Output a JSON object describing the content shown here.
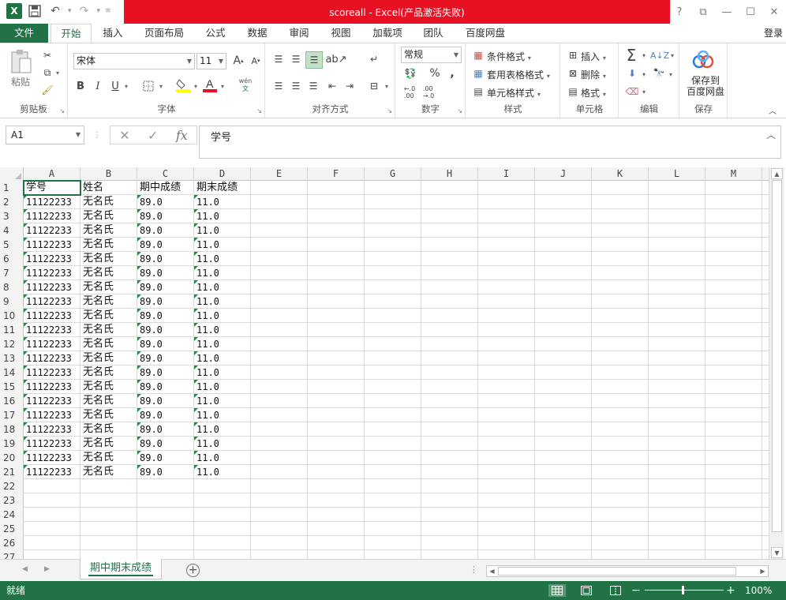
{
  "app": {
    "title": "scoreall -  Excel(产品激活失败)",
    "logo": "X",
    "login": "登录"
  },
  "window_controls": [
    "?",
    "⧉",
    "—",
    "☐",
    "✕"
  ],
  "tabs": [
    {
      "label": "文件"
    },
    {
      "label": "开始"
    },
    {
      "label": "插入"
    },
    {
      "label": "页面布局"
    },
    {
      "label": "公式"
    },
    {
      "label": "数据"
    },
    {
      "label": "审阅"
    },
    {
      "label": "视图"
    },
    {
      "label": "加载项"
    },
    {
      "label": "团队"
    },
    {
      "label": "百度网盘"
    }
  ],
  "ribbon": {
    "clipboard": {
      "label": "剪贴板",
      "paste": "粘贴"
    },
    "font": {
      "label": "字体",
      "name": "宋体",
      "size": "11",
      "bold": "B",
      "italic": "I",
      "underline": "U",
      "phonetic": "wén"
    },
    "alignment": {
      "label": "对齐方式"
    },
    "number": {
      "label": "数字",
      "format": "常规",
      "percent": "%",
      "comma": ","
    },
    "styles": {
      "label": "样式",
      "conditional": "条件格式",
      "table": "套用表格格式",
      "cell": "单元格样式"
    },
    "cells": {
      "label": "单元格",
      "insert": "插入",
      "delete": "删除",
      "format": "格式"
    },
    "editing": {
      "label": "编辑"
    },
    "save": {
      "label": "保存",
      "button": "保存到\n百度网盘"
    }
  },
  "formula_bar": {
    "name_box": "A1",
    "fx": "fx",
    "value": "学号"
  },
  "columns": [
    "A",
    "B",
    "C",
    "D",
    "E",
    "F",
    "G",
    "H",
    "I",
    "J",
    "K",
    "L",
    "M"
  ],
  "header_row": [
    "学号",
    "姓名",
    "期中成绩",
    "期末成绩"
  ],
  "data_rows": [
    [
      "11122233",
      "无名氏",
      "89.0",
      "11.0"
    ],
    [
      "11122233",
      "无名氏",
      "89.0",
      "11.0"
    ],
    [
      "11122233",
      "无名氏",
      "89.0",
      "11.0"
    ],
    [
      "11122233",
      "无名氏",
      "89.0",
      "11.0"
    ],
    [
      "11122233",
      "无名氏",
      "89.0",
      "11.0"
    ],
    [
      "11122233",
      "无名氏",
      "89.0",
      "11.0"
    ],
    [
      "11122233",
      "无名氏",
      "89.0",
      "11.0"
    ],
    [
      "11122233",
      "无名氏",
      "89.0",
      "11.0"
    ],
    [
      "11122233",
      "无名氏",
      "89.0",
      "11.0"
    ],
    [
      "11122233",
      "无名氏",
      "89.0",
      "11.0"
    ],
    [
      "11122233",
      "无名氏",
      "89.0",
      "11.0"
    ],
    [
      "11122233",
      "无名氏",
      "89.0",
      "11.0"
    ],
    [
      "11122233",
      "无名氏",
      "89.0",
      "11.0"
    ],
    [
      "11122233",
      "无名氏",
      "89.0",
      "11.0"
    ],
    [
      "11122233",
      "无名氏",
      "89.0",
      "11.0"
    ],
    [
      "11122233",
      "无名氏",
      "89.0",
      "11.0"
    ],
    [
      "11122233",
      "无名氏",
      "89.0",
      "11.0"
    ],
    [
      "11122233",
      "无名氏",
      "89.0",
      "11.0"
    ],
    [
      "11122233",
      "无名氏",
      "89.0",
      "11.0"
    ],
    [
      "11122233",
      "无名氏",
      "89.0",
      "11.0"
    ]
  ],
  "row_numbers": [
    "1",
    "2",
    "3",
    "4",
    "5",
    "6",
    "7",
    "8",
    "9",
    "10",
    "11",
    "12",
    "13",
    "14",
    "15",
    "16",
    "17",
    "18",
    "19",
    "20",
    "21",
    "22",
    "23",
    "24",
    "25",
    "26",
    "27"
  ],
  "sheet": {
    "tab": "期中期末成绩",
    "add": "+"
  },
  "status": {
    "text": "就绪",
    "zoom_minus": "−",
    "zoom_plus": "+",
    "zoom": "100%"
  },
  "colors": {
    "accent": "#217346",
    "title_bar": "#e81123",
    "flag": "#1e8e3e"
  }
}
